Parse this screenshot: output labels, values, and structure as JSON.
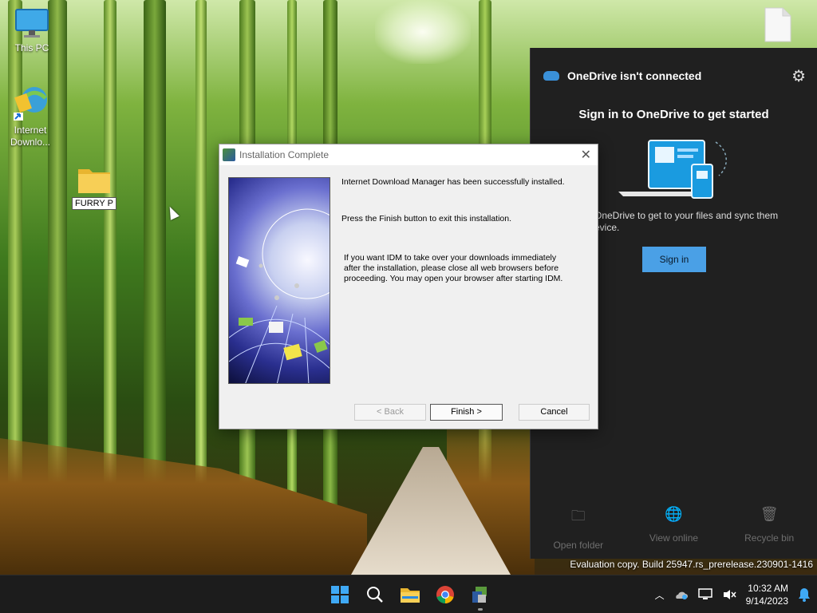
{
  "desktop": {
    "icons": [
      {
        "name": "This PC"
      },
      {
        "name": "Internet Downlo..."
      },
      {
        "name": "FURRY P"
      }
    ]
  },
  "onedrive": {
    "title": "OneDrive isn't connected",
    "heading": "Sign in to OneDrive to get started",
    "description": "OneDrive to get to your files and sync them evice.",
    "signin_label": "Sign in",
    "actions": [
      {
        "label": "Open folder",
        "icon": "folder-icon"
      },
      {
        "label": "View online",
        "icon": "globe-icon"
      },
      {
        "label": "Recycle bin",
        "icon": "trash-icon"
      }
    ],
    "accent": "#4aa0e6"
  },
  "watermark": "Evaluation copy. Build 25947.rs_prerelease.230901-1416",
  "dialog": {
    "title": "Installation Complete",
    "line1": "Internet Download Manager has been successfully installed.",
    "line2": "Press the Finish button to exit this installation.",
    "line3a": "If you want IDM to take over your downloads immediately",
    "line3b": "after the installation, please close all web browsers before",
    "line3c": "proceeding. You may open your browser after starting IDM.",
    "back_label": "< Back",
    "finish_label": "Finish >",
    "cancel_label": "Cancel"
  },
  "taskbar": {
    "apps": [
      "start-icon",
      "search-icon",
      "file-explorer-icon",
      "chrome-icon",
      "idm-installer-icon"
    ],
    "time": "10:32 AM",
    "date": "9/14/2023"
  }
}
